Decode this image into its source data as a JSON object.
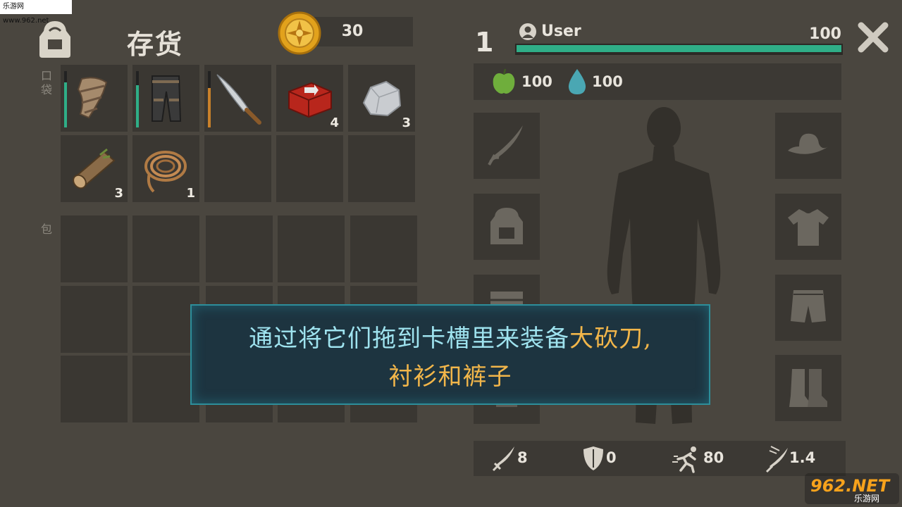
{
  "watermark": {
    "top_text": "乐游网 www.962.net",
    "logo_text": "962.NET",
    "logo_sub": "乐游网"
  },
  "inventory": {
    "title": "存货",
    "coins": "30",
    "pocket_label": "口袋",
    "bag_label": "包",
    "pocket_slots": [
      {
        "item": "bandage-armor-icon",
        "count": "",
        "durability": 0.8,
        "dur_color": "#2fae87"
      },
      {
        "item": "pants-icon",
        "count": "",
        "durability": 0.75,
        "dur_color": "#2fae87"
      },
      {
        "item": "machete-icon",
        "count": "",
        "durability": 0.7,
        "dur_color": "#c8802a"
      },
      {
        "item": "medkit-icon",
        "count": "4"
      },
      {
        "item": "stone-icon",
        "count": "3"
      },
      {
        "item": "wood-log-icon",
        "count": "3"
      },
      {
        "item": "rope-icon",
        "count": "1"
      },
      {
        "item": "empty"
      },
      {
        "item": "empty"
      },
      {
        "item": "empty"
      }
    ]
  },
  "character": {
    "level": "1",
    "username": "User",
    "health": "100",
    "health_fraction": 1.0,
    "food": "100",
    "water": "100",
    "stats": {
      "damage": "8",
      "armor": "0",
      "speed": "80",
      "attack_speed": "1.4"
    }
  },
  "tooltip": {
    "text_part1": "通过将它们拖到卡槽里来装备",
    "highlight1": "大砍刀",
    "text_part2": ",",
    "highlight2": "衬衫和裤子"
  },
  "colors": {
    "health": "#2fae87",
    "tooltip_border": "#2d8e9a",
    "highlight": "#f2b64a"
  }
}
